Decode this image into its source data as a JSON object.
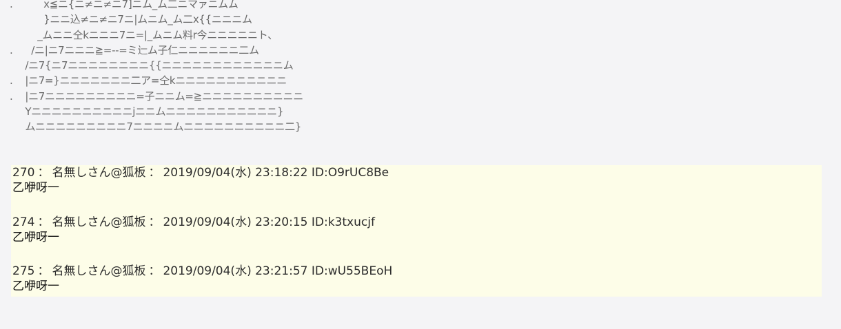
{
  "ascii_art": [
    ".          x≦ニ{ニ≠ニ≠ニ7]ニム_ム二ニマァニムム",
    "           }ニニ込≠ニ≠ニ7ニ|ムニム_ム二x{{ニニニム",
    "         _ムニニ仝kニニニ7ニ=|_ムニム料r今ニニニニニト、",
    ".      /ニ|ニ7ニニニ≧=--=ミ辷ム子仁ニニニニニニ二ム",
    "     /ニ7{ニ7ニニニニニニニニ{{ニニニニニニニニニニニニム",
    ".    |ニ7=}ニニニニニニニ二ア=仝kニニニニニニニニニニニ",
    ".    |ニ7ニニニニニニニニニ=子ニニム=≧ニニニニニニニニニニ",
    "     Yニニニニニニニニニニjニニムニニニニニニニニニニニ}",
    "     ムニニニニニニニニニ7ニニニニムニニニニニニニニニニ二}"
  ],
  "posts": [
    {
      "number": "270",
      "name": "名無しさん@狐板",
      "date": "2019/09/04(水) 23:18:22",
      "id": "ID:O9rUC8Be",
      "body": "乙咿呀一"
    },
    {
      "number": "274",
      "name": "名無しさん@狐板",
      "date": "2019/09/04(水) 23:20:15",
      "id": "ID:k3txucjf",
      "body": "乙咿呀一"
    },
    {
      "number": "275",
      "name": "名無しさん@狐板",
      "date": "2019/09/04(水) 23:21:57",
      "id": "ID:wU55BEoH",
      "body": "乙咿呀一"
    }
  ],
  "separator": "："
}
